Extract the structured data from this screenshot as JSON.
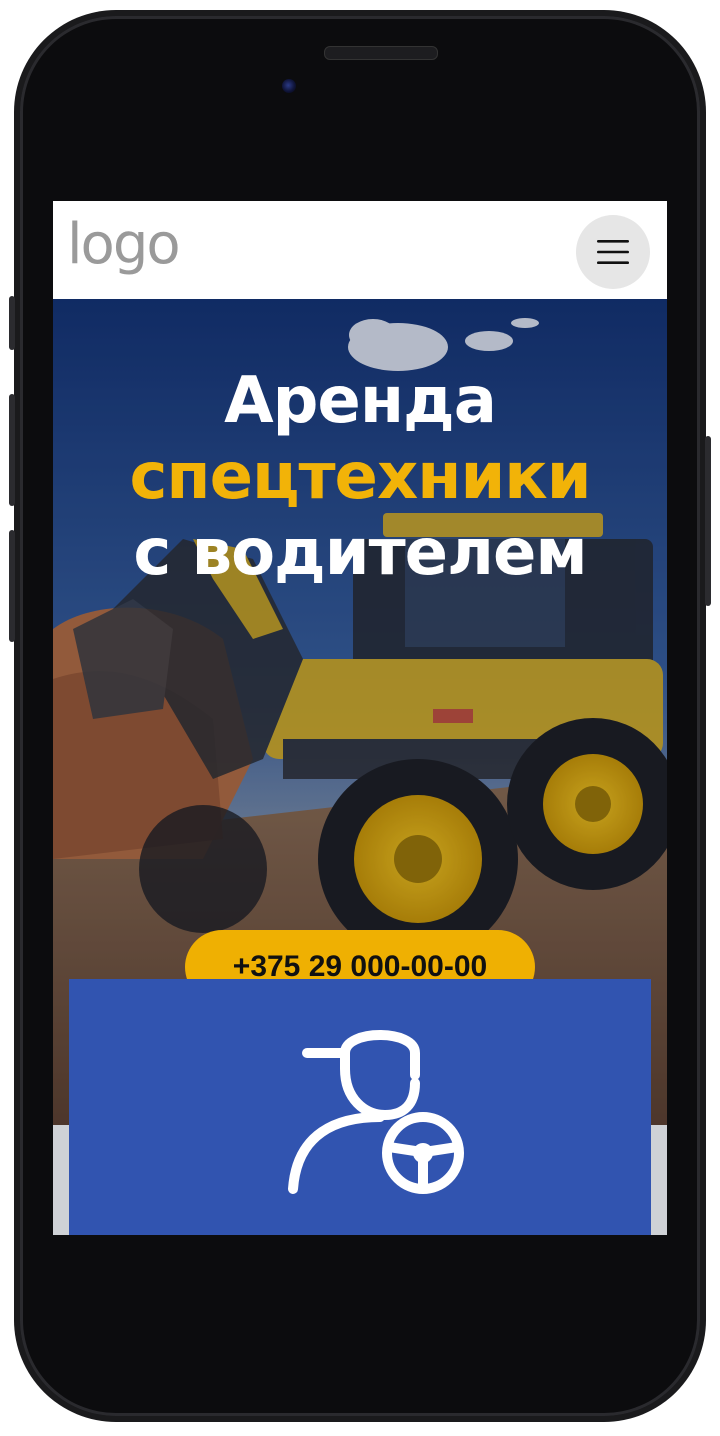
{
  "header": {
    "logo_text": "logo",
    "menu_icon": "hamburger-menu-icon"
  },
  "hero": {
    "title_line1": "Аренда",
    "title_line2": "спецтехники",
    "title_line3": "с водителем",
    "phone_button": "+375 29 000-00-00",
    "background_image": "yellow backhoe loader on a construction site"
  },
  "feature_card": {
    "icon": "driver-steering-wheel-icon"
  },
  "colors": {
    "accent_yellow": "#f2b308",
    "button_yellow": "#efb002",
    "card_blue": "#3154b0",
    "title_white": "#ffffff",
    "logo_gray": "#9a9a9a"
  }
}
